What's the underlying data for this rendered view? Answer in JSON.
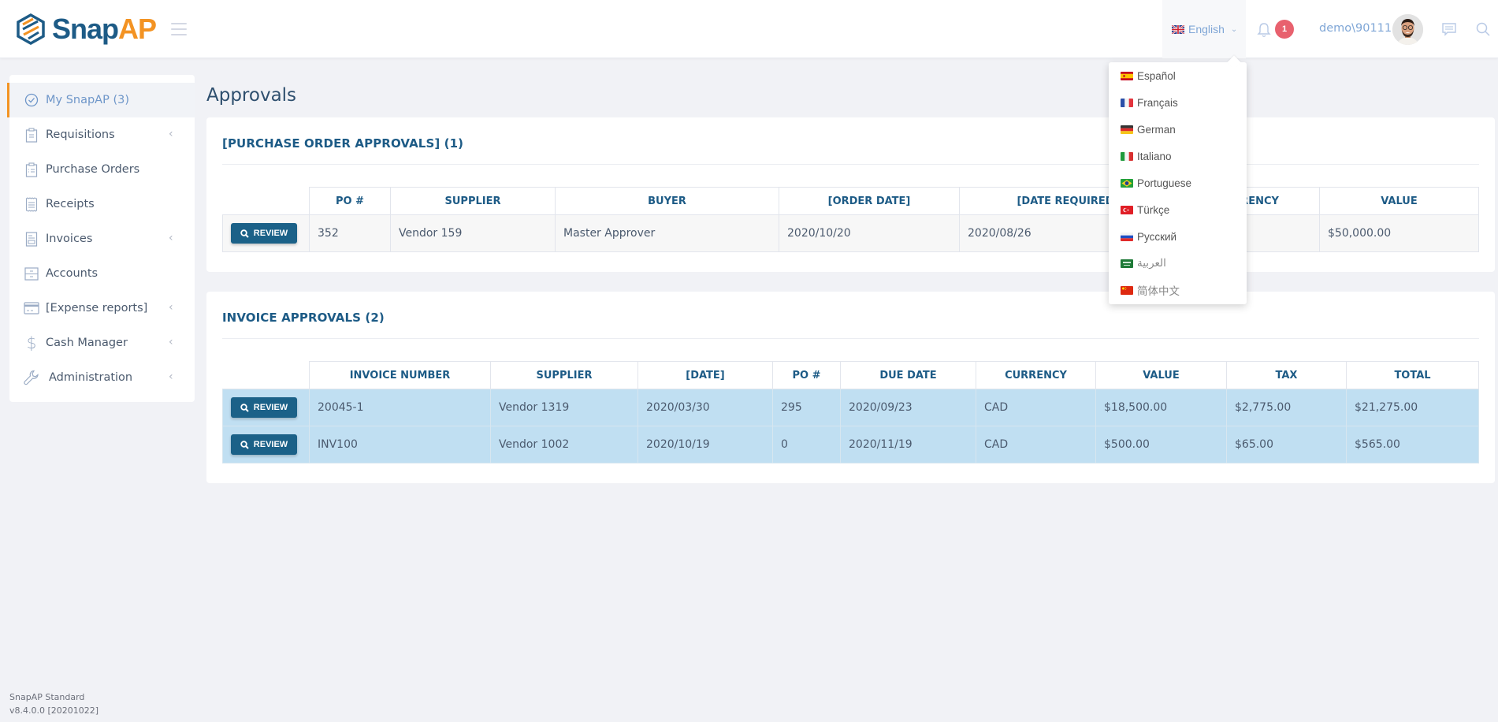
{
  "app": {
    "logo_primary": "Snap",
    "logo_accent": "AP"
  },
  "header": {
    "language": {
      "label": "English",
      "flag": "gb-flag-icon"
    },
    "notifications": {
      "count": "1"
    },
    "username": "demo\\90111"
  },
  "language_menu": {
    "items": [
      {
        "label": "Español",
        "flag": "es"
      },
      {
        "label": "Français",
        "flag": "fr"
      },
      {
        "label": "German",
        "flag": "de"
      },
      {
        "label": "Italiano",
        "flag": "it"
      },
      {
        "label": "Portuguese",
        "flag": "br"
      },
      {
        "label": "Türkçe",
        "flag": "tr"
      },
      {
        "label": "Русский",
        "flag": "ru"
      },
      {
        "label": "العربية",
        "flag": "sa"
      },
      {
        "label": "简体中文",
        "flag": "cn"
      }
    ]
  },
  "sidebar": {
    "items": [
      {
        "label": "My SnapAP (3)",
        "icon": "check-circle-icon",
        "active": true,
        "has_submenu": false
      },
      {
        "label": "Requisitions",
        "icon": "clipboard-icon",
        "has_submenu": true
      },
      {
        "label": "Purchase Orders",
        "icon": "clipboard-list-icon",
        "has_submenu": false
      },
      {
        "label": "Receipts",
        "icon": "receipt-icon",
        "has_submenu": false
      },
      {
        "label": "Invoices",
        "icon": "invoice-icon",
        "has_submenu": true
      },
      {
        "label": "Accounts",
        "icon": "cabinet-icon",
        "has_submenu": false
      },
      {
        "label": "[Expense reports]",
        "icon": "credit-card-icon",
        "has_submenu": true
      },
      {
        "label": "Cash Manager",
        "icon": "dollar-icon",
        "has_submenu": true
      },
      {
        "label": "Administration",
        "icon": "wrench-icon",
        "has_submenu": true
      }
    ],
    "submenu_arrow": "‹"
  },
  "main": {
    "page_title": "Approvals",
    "review_label": "REVIEW",
    "po_section": {
      "title": "[PURCHASE ORDER APPROVALS] (1)",
      "columns": [
        "PO #",
        "SUPPLIER",
        "BUYER",
        "[ORDER DATE]",
        "[DATE REQUIRED]",
        "CURRENCY",
        "VALUE"
      ],
      "rows": [
        [
          "352",
          "Vendor 159",
          "Master Approver",
          "2020/10/20",
          "2020/08/26",
          "",
          "$50,000.00"
        ]
      ]
    },
    "invoice_section": {
      "title": "INVOICE APPROVALS (2)",
      "columns": [
        "INVOICE NUMBER",
        "SUPPLIER",
        "[DATE]",
        "PO #",
        "DUE DATE",
        "CURRENCY",
        "VALUE",
        "TAX",
        "TOTAL"
      ],
      "rows": [
        [
          "20045-1",
          "Vendor 1319",
          "2020/03/30",
          "295",
          "2020/09/23",
          "CAD",
          "$18,500.00",
          "$2,775.00",
          "$21,275.00"
        ],
        [
          "INV100",
          "Vendor 1002",
          "2020/10/19",
          "0",
          "2020/11/19",
          "CAD",
          "$500.00",
          "$65.00",
          "$565.00"
        ]
      ]
    }
  },
  "footer": {
    "product": "SnapAP Standard",
    "version": "v8.4.0.0 [20201022]"
  }
}
